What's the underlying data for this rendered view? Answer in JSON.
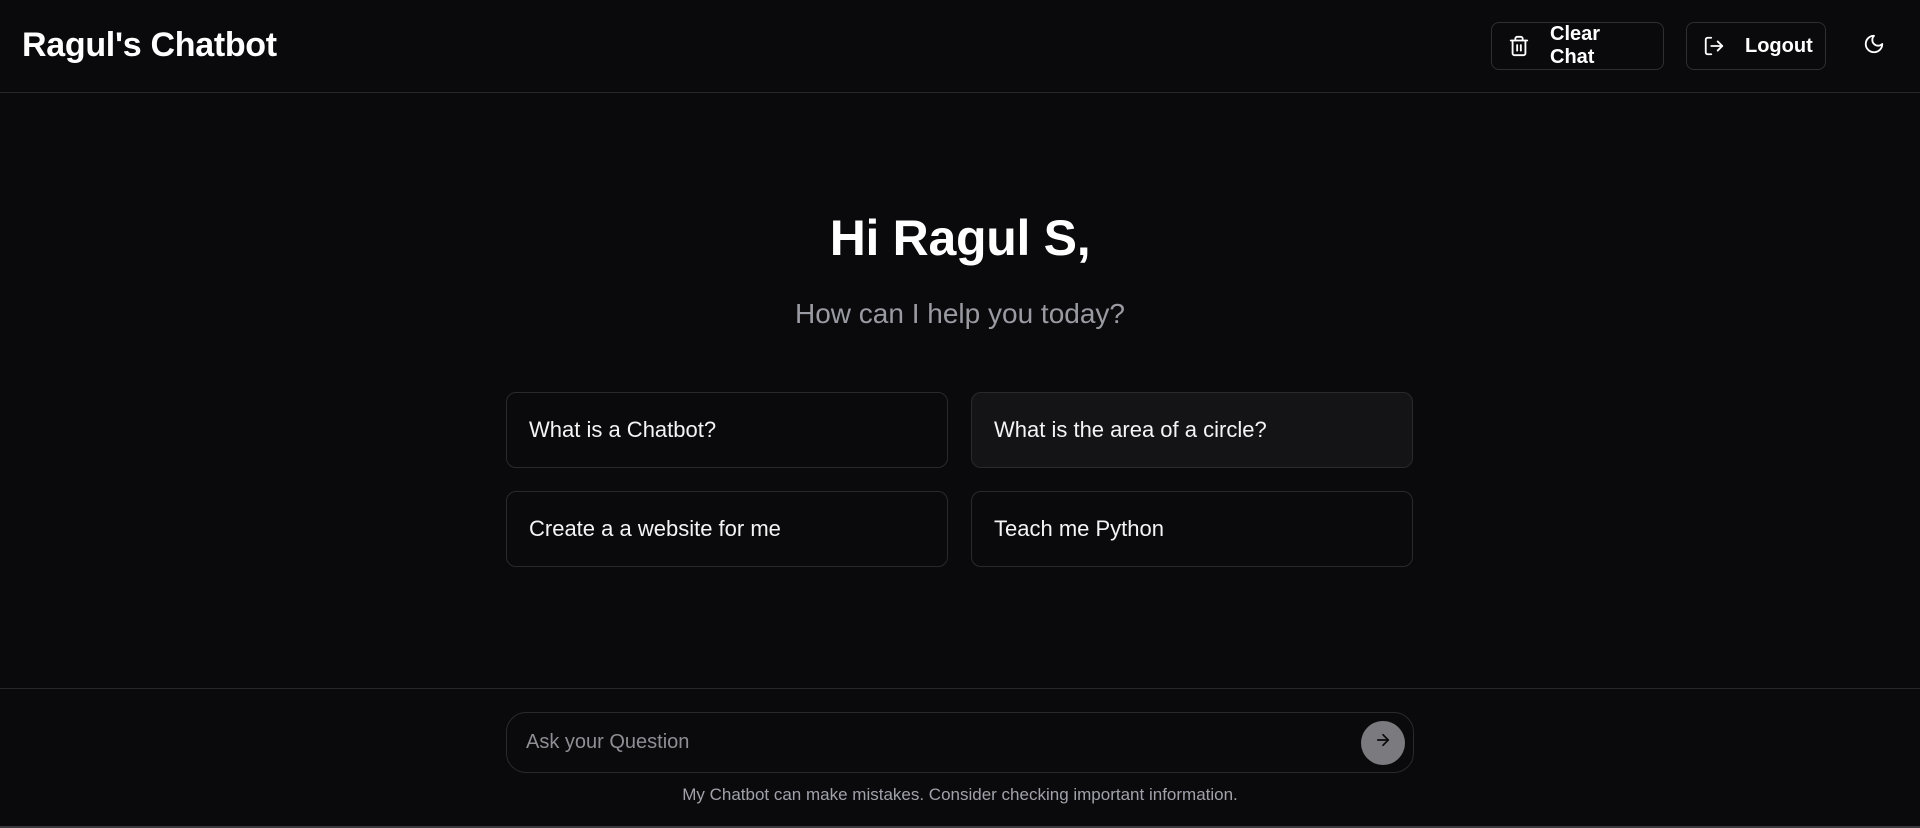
{
  "header": {
    "title": "Ragul's Chatbot",
    "clear_label": "Clear Chat",
    "logout_label": "Logout",
    "theme_icon": "moon-icon"
  },
  "main": {
    "greeting": "Hi Ragul S,",
    "subtitle": "How can I help you today?",
    "suggestions": [
      "What is a Chatbot?",
      "What is the area of a circle?",
      "Create a a website for me",
      "Teach me Python"
    ]
  },
  "composer": {
    "placeholder": "Ask your Question",
    "value": "",
    "send_icon": "arrow-right-icon",
    "disclaimer": "My Chatbot can make mistakes. Consider checking important information."
  },
  "colors": {
    "background": "#0a0a0c",
    "border": "#27272a",
    "text": "#fafafa",
    "muted": "#9a9aa2",
    "send_button": "#7b7b7f"
  }
}
